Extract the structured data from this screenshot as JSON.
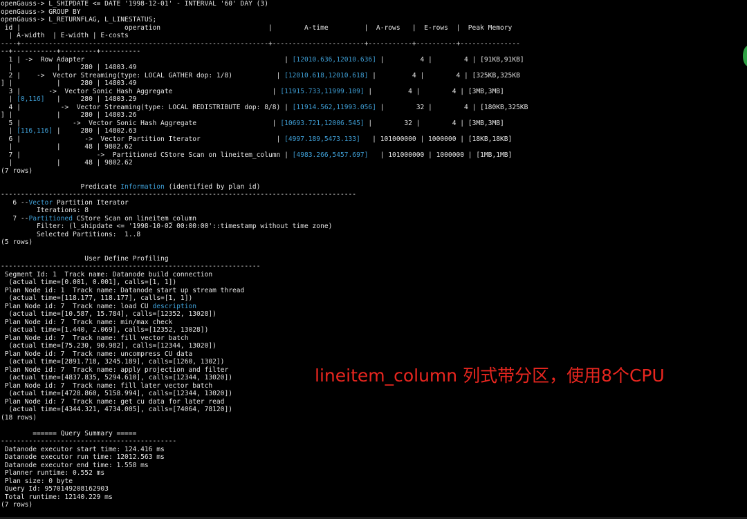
{
  "terminal": {
    "lines": [
      [
        "openGauss-> L_SHIPDATE <= DATE '1998-12-01' - INTERVAL '60' DAY (3)"
      ],
      [
        "openGauss-> GROUP BY"
      ],
      [
        "openGauss-> L_RETURNFLAG, L_LINESTATUS;"
      ],
      [
        " id |                          operation                           |        A-time         |  A-rows   |  E-rows  |  Peak Memory"
      ],
      [
        "  | A-width  | E-width | E-costs"
      ],
      [
        "----+--------------------------------------------------------------+-----------------------+-----------+----------+---------------"
      ],
      [
        "--+-----------+---------+----------"
      ],
      [
        "  1 | ->  Row Adapter                                                  | ",
        {
          "t": "[12010.636,12010.636]"
        },
        " |         4 |        4 | [91KB,91KB]"
      ],
      [
        "  |           |     280 | 14803.49"
      ],
      [
        "  2 |    ->  Vector Streaming(type: LOCAL GATHER dop: 1/8)           | ",
        {
          "t": "[12010.618,12010.618]"
        },
        " |         4 |        4 | [325KB,325KB"
      ],
      [
        "] |           |     280 | 14803.49"
      ],
      [
        "  3 |       ->  Vector Sonic Hash Aggregate                         | ",
        {
          "t": "[11915.733,11999.109]"
        },
        " |         4 |        4 | [3MB,3MB]"
      ],
      [
        "  | ",
        {
          "t": "[0,116]"
        },
        "   |     280 | 14803.29"
      ],
      [
        "  4 |          ->  Vector Streaming(type: LOCAL REDISTRIBUTE dop: 8/8) | ",
        {
          "t": "[11914.562,11993.056]"
        },
        " |        32 |        4 | [180KB,325KB"
      ],
      [
        "] |           |     280 | 14803.26"
      ],
      [
        "  5 |             ->  Vector Sonic Hash Aggregate                   | ",
        {
          "t": "[10693.721,12006.545]"
        },
        " |        32 |        4 | [3MB,3MB]"
      ],
      [
        "  | ",
        {
          "t": "[116,116]"
        },
        " |     280 | 14802.63"
      ],
      [
        "  6 |                ->  Vector Partition Iterator                   | ",
        {
          "t": "[4997.189,5473.133]"
        },
        "   | 101000000 | 1000000 | [18KB,18KB]"
      ],
      [
        "  |           |      48 | 9802.62"
      ],
      [
        "  7 |                   ->  Partitioned CStore Scan on lineitem_column | ",
        {
          "t": "[4983.266,5457.697]"
        },
        "   | 101000000 | 1000000 | [1MB,1MB]"
      ],
      [
        "  |           |      48 | 9802.62"
      ],
      [
        "(7 rows)"
      ],
      [
        ""
      ],
      [
        "                    Predicate ",
        {
          "t": "Information"
        },
        " (identified by plan id)"
      ],
      [
        "-----------------------------------------------------------------------------------------"
      ],
      [
        "   6 --",
        {
          "t": "Vector"
        },
        " Partition Iterator"
      ],
      [
        "         Iterations: 8"
      ],
      [
        "   7 --",
        {
          "t": "Partitioned"
        },
        " CStore Scan on lineitem_column"
      ],
      [
        "         Filter: (l_shipdate <= '1998-10-02 00:00:00'::timestamp without time zone)"
      ],
      [
        "         Selected Partitions:  1..8"
      ],
      [
        "(5 rows)"
      ],
      [
        ""
      ],
      [
        "                     User Define Profiling"
      ],
      [
        "-----------------------------------------------------------------"
      ],
      [
        " Segment Id: 1  Track name: Datanode build connection"
      ],
      [
        "  (actual time=[0.001, 0.001], calls=[1, 1])"
      ],
      [
        " Plan Node id: 1  Track name: Datanode start up stream thread"
      ],
      [
        "  (actual time=[118.177, 118.177], calls=[1, 1])"
      ],
      [
        " Plan Node id: 7  Track name: load CU ",
        {
          "t": "description"
        }
      ],
      [
        "  (actual time=[10.587, 15.784], calls=[12352, 13028])"
      ],
      [
        " Plan Node id: 7  Track name: min/max check"
      ],
      [
        "  (actual time=[1.440, 2.069], calls=[12352, 13028])"
      ],
      [
        " Plan Node id: 7  Track name: fill vector batch"
      ],
      [
        "  (actual time=[75.230, 90.982], calls=[12344, 13020])"
      ],
      [
        " Plan Node id: 7  Track name: uncompress CU data"
      ],
      [
        "  (actual time=[2891.718, 3245.189], calls=[1260, 1302])"
      ],
      [
        " Plan Node id: 7  Track name: apply projection and filter"
      ],
      [
        "  (actual time=[4837.835, 5294.610], calls=[12344, 13020])"
      ],
      [
        " Plan Node id: 7  Track name: fill later vector batch"
      ],
      [
        "  (actual time=[4728.860, 5158.994], calls=[12344, 13020])"
      ],
      [
        " Plan Node id: 7  Track name: get cu data for later read"
      ],
      [
        "  (actual time=[4344.321, 4734.005], calls=[74064, 78120])"
      ],
      [
        "(18 rows)"
      ],
      [
        ""
      ],
      [
        "        ====== Query Summary ====="
      ],
      [
        "--------------------------------------------"
      ],
      [
        " Datanode executor start time: 124.416 ms"
      ],
      [
        " Datanode executor run time: 12012.563 ms"
      ],
      [
        " Datanode executor end time: 1.558 ms"
      ],
      [
        " Planner runtime: 0.552 ms"
      ],
      [
        " Plan size: 0 byte"
      ],
      [
        " Query Id: 95701492081 62903"
      ],
      [
        " Total runtime: 12140.229 ms"
      ],
      [
        "(7 rows)"
      ]
    ]
  },
  "annotation": {
    "text": "lineitem_column 列式带分区，使用8个CPU"
  },
  "colors": {
    "background": "#000000",
    "text": "#e6e6e6",
    "highlight": "#3f9fd6",
    "annotation": "#e8261f"
  }
}
